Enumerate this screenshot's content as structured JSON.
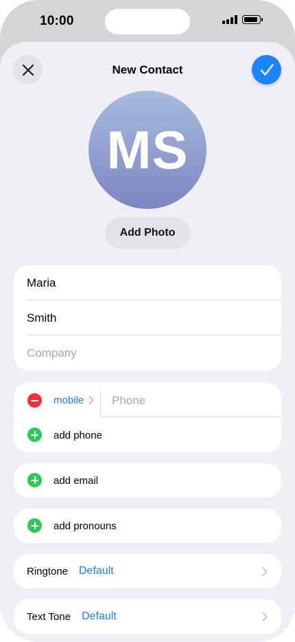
{
  "status_bar": {
    "time": "10:00"
  },
  "nav": {
    "title": "New Contact"
  },
  "avatar": {
    "initials": "MS"
  },
  "add_photo_label": "Add Photo",
  "name_card": {
    "first_name": "Maria",
    "last_name": "Smith",
    "company_placeholder": "Company"
  },
  "phone_card": {
    "phone_label": "mobile",
    "phone_placeholder": "Phone",
    "add_phone_label": "add phone"
  },
  "add_email_label": "add email",
  "add_pronouns_label": "add pronouns",
  "ringtone": {
    "label": "Ringtone",
    "value": "Default"
  },
  "text_tone": {
    "label": "Text Tone",
    "value": "Default"
  },
  "colors": {
    "accent": "#1a84ff",
    "link": "#1b7fe0",
    "remove": "#f2303c",
    "add": "#2fc95b",
    "sheet_background": "#f0eff5"
  },
  "icons": [
    "close-icon",
    "checkmark-icon",
    "remove-circle-icon",
    "add-circle-icon",
    "chevron-right-icon",
    "signal-icon",
    "battery-icon"
  ]
}
